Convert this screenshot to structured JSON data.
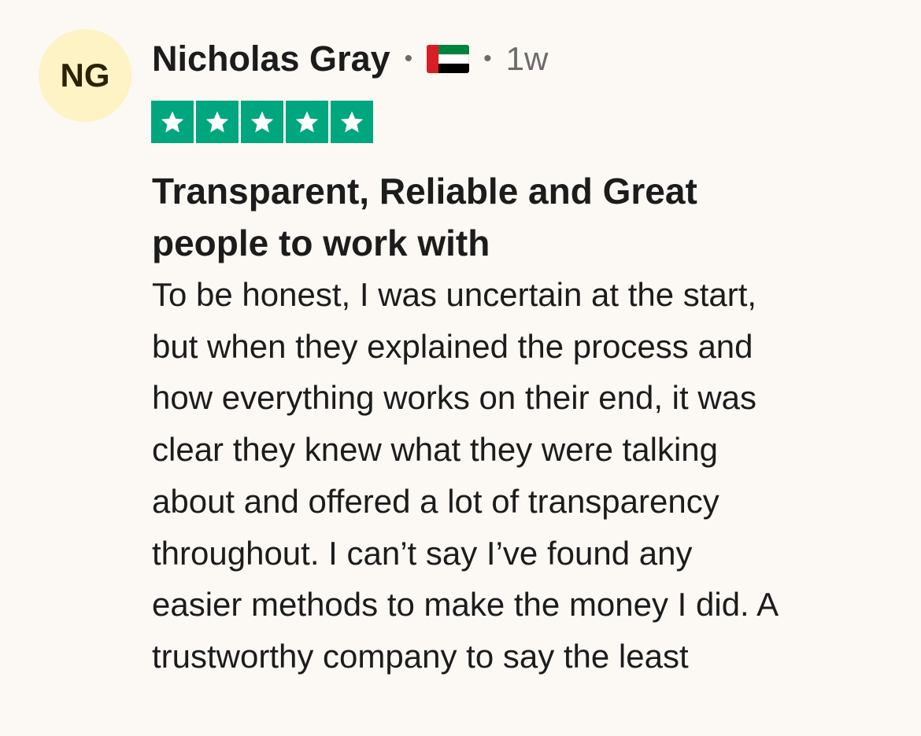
{
  "review": {
    "avatar_initials": "NG",
    "reviewer_name": "Nicholas Gray",
    "separator": "•",
    "country_flag_icon": "uae-flag-icon",
    "time_ago": "1w",
    "rating": 5,
    "rating_max": 5,
    "star_color": "#00a67e",
    "title_lines": [
      "Transparent, Reliable and Great",
      "people to work with"
    ],
    "body_lines": [
      "To be honest, I was uncertain at the start,",
      "but when they explained the process and",
      "how everything works on their end, it was",
      "clear they knew what they were talking",
      "about and offered a lot of transparency",
      "throughout. I can’t say I’ve found any",
      "easier methods to make the money I did. A",
      "trustworthy company to say the least"
    ]
  }
}
